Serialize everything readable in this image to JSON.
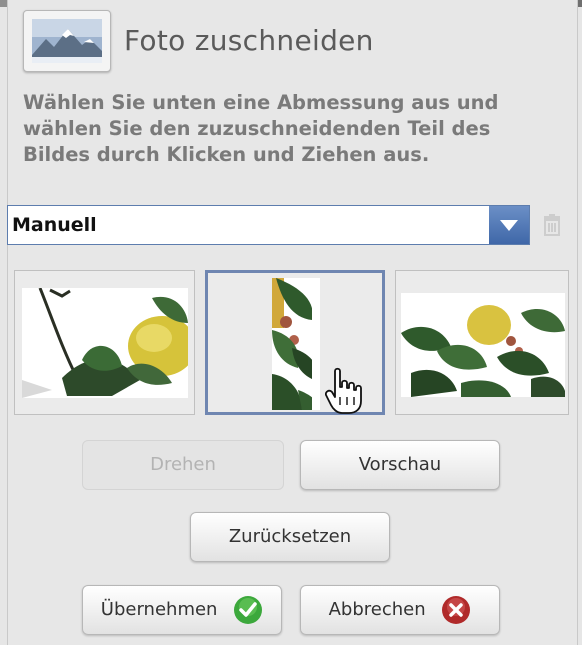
{
  "dialog": {
    "title": "Foto zuschneiden",
    "description_lines": [
      "Wählen Sie unten eine Abmessung aus und",
      "wählen Sie den zuzuschneidenden Teil des",
      "Bildes durch Klicken und Ziehen aus."
    ]
  },
  "dimension_select": {
    "selected": "Manuell"
  },
  "crop_options": [
    {
      "name": "crop-option-left",
      "selected": false
    },
    {
      "name": "crop-option-center",
      "selected": true
    },
    {
      "name": "crop-option-right",
      "selected": false
    }
  ],
  "buttons": {
    "rotate": "Drehen",
    "preview": "Vorschau",
    "reset": "Zurücksetzen",
    "apply": "Übernehmen",
    "cancel": "Abbrechen"
  },
  "icons": {
    "dialog": "photo-thumbnail-icon",
    "dropdown": "chevron-down-icon",
    "delete": "trash-icon",
    "apply": "check-circle-icon",
    "cancel": "x-circle-icon",
    "pointer": "hand-cursor-icon"
  },
  "colors": {
    "accent": "#4a6fb0",
    "apply_icon": "#3ca83c",
    "cancel_icon": "#b02a2a"
  }
}
